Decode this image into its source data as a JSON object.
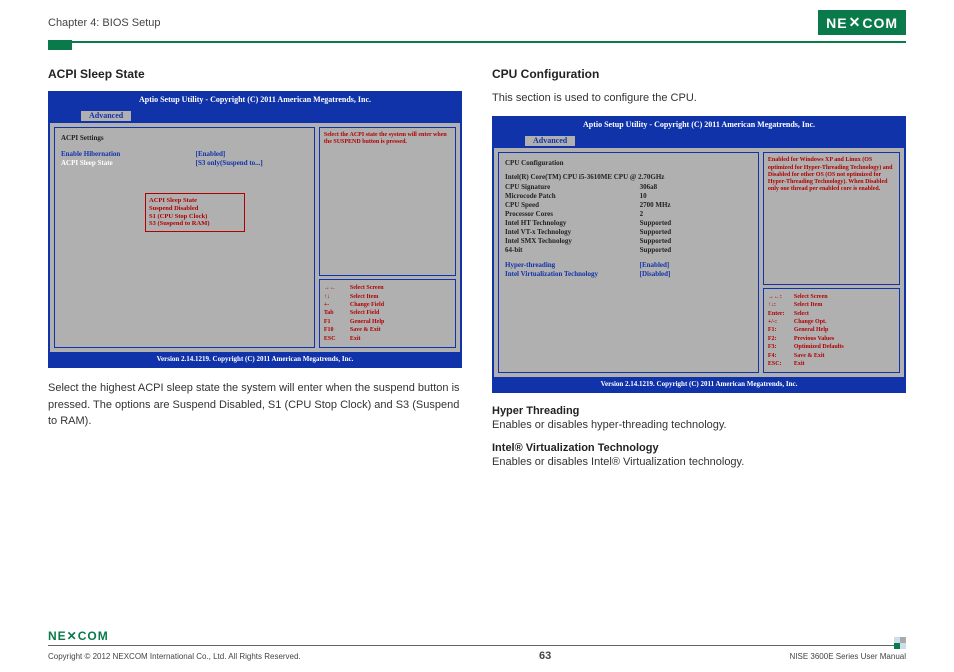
{
  "header": {
    "chapter": "Chapter 4: BIOS Setup",
    "logo": "NEXCOM"
  },
  "left": {
    "title": "ACPI Sleep State",
    "bios": {
      "titlebar": "Aptio Setup Utility - Copyright (C) 2011 American Megatrends, Inc.",
      "tab": "Advanced",
      "group_header": "ACPI Settings",
      "rows": [
        {
          "label": "Enable Hibernation",
          "value": "[Enabled]"
        },
        {
          "label": "ACPI Sleep State",
          "value": "[S3 only(Suspend to...]"
        }
      ],
      "popup": {
        "title": "ACPI Sleep State",
        "opt1": "Suspend Disabled",
        "opt2": "S1 (CPU Stop Clock)",
        "opt3": "S3 (Suspend to RAM)"
      },
      "help": "Select the ACPI state the system will enter when the SUSPEND button is pressed.",
      "nav": [
        {
          "k": "→←",
          "t": "Select Screen"
        },
        {
          "k": "↑↓",
          "t": "Select Item"
        },
        {
          "k": "+-",
          "t": "Change Field"
        },
        {
          "k": "Tab",
          "t": "Select Field"
        },
        {
          "k": "F1",
          "t": "General Help"
        },
        {
          "k": "F10",
          "t": "Save & Exit"
        },
        {
          "k": "ESC",
          "t": "Exit"
        }
      ],
      "footer": "Version 2.14.1219. Copyright (C) 2011 American Megatrends, Inc."
    },
    "description": "Select the highest ACPI sleep state the system will enter when the suspend button is pressed. The options are Suspend Disabled, S1 (CPU Stop Clock) and S3 (Suspend to RAM)."
  },
  "right": {
    "title": "CPU Configuration",
    "subtitle": "This section is used to configure the CPU.",
    "bios": {
      "titlebar": "Aptio Setup Utility - Copyright (C) 2011 American Megatrends, Inc.",
      "tab": "Advanced",
      "group_header": "CPU Configuration",
      "cpu_name": "Intel(R) Core(TM) CPU i5-3610ME CPU @ 2.70GHz",
      "rows": [
        {
          "label": "CPU Signature",
          "value": "306a8"
        },
        {
          "label": "Microcode Patch",
          "value": "10"
        },
        {
          "label": "CPU Speed",
          "value": "2700 MHz"
        },
        {
          "label": "Processor Cores",
          "value": "2"
        },
        {
          "label": "Intel HT Technology",
          "value": "Supported"
        },
        {
          "label": "Intel VT-x Technology",
          "value": "Supported"
        },
        {
          "label": "Intel SMX Technology",
          "value": "Supported"
        },
        {
          "label": "64-bit",
          "value": "Supported"
        }
      ],
      "options": [
        {
          "label": "Hyper-threading",
          "value": "[Enabled]"
        },
        {
          "label": "Intel Virtualization Technology",
          "value": "[Disabled]"
        }
      ],
      "help": "Enabled for Windows XP and Linux (OS optimized for Hyper-Threading Technology) and Disabled for other OS (OS not optimized for Hyper-Threading Technology). When Disabled only one thread per enabled core is enabled.",
      "nav": [
        {
          "k": "→←:",
          "t": "Select Screen"
        },
        {
          "k": "↑↓:",
          "t": "Select Item"
        },
        {
          "k": "Enter:",
          "t": "Select"
        },
        {
          "k": "+/-:",
          "t": "Change Opt."
        },
        {
          "k": "F1:",
          "t": "General Help"
        },
        {
          "k": "F2:",
          "t": "Previous Values"
        },
        {
          "k": "F3:",
          "t": "Optimized Defaults"
        },
        {
          "k": "F4:",
          "t": "Save & Exit"
        },
        {
          "k": "ESC:",
          "t": "Exit"
        }
      ],
      "footer": "Version 2.14.1219. Copyright (C) 2011 American Megatrends, Inc."
    },
    "sections": [
      {
        "heading": "Hyper Threading",
        "text": "Enables or disables hyper-threading technology."
      },
      {
        "heading": "Intel® Virtualization Technology",
        "text": "Enables or disables Intel® Virtualization technology."
      }
    ]
  },
  "footer": {
    "logo": "NEXCOM",
    "copyright": "Copyright © 2012 NEXCOM International Co., Ltd. All Rights Reserved.",
    "page": "63",
    "manual": "NISE 3600E Series User Manual"
  }
}
